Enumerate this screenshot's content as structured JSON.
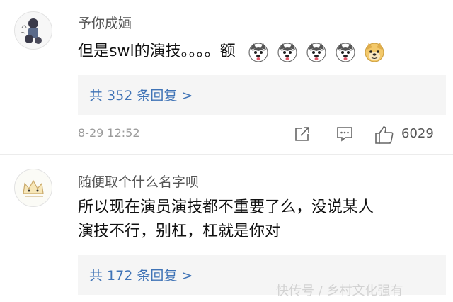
{
  "comments": [
    {
      "username": "予你成婳",
      "text": "但是swl的演技。。。。额",
      "emojis": [
        "husky-emoji",
        "husky-emoji",
        "husky-emoji",
        "husky-emoji",
        "doge-emoji"
      ],
      "replies": "共 352 条回复 >",
      "time": "8-29 12:52",
      "likes": "6029"
    },
    {
      "username": "随便取个什么名字呗",
      "text_line1": "所以现在演员演技都不重要了么，没说某人",
      "text_line2": "演技不行，别杠，杠就是你对",
      "replies": "共 172 条回复 >"
    }
  ],
  "watermark": "快传号 / 乡村文化强有"
}
